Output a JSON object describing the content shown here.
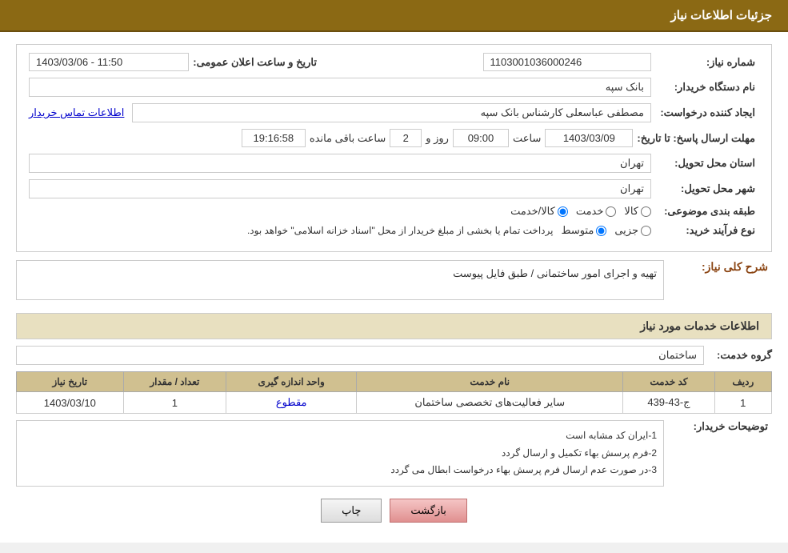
{
  "header": {
    "title": "جزئیات اطلاعات نیاز"
  },
  "fields": {
    "need_number_label": "شماره نیاز:",
    "need_number_value": "1103001036000246",
    "buyer_org_label": "نام دستگاه خریدار:",
    "buyer_org_value": "بانک سپه",
    "creator_label": "ایجاد کننده درخواست:",
    "creator_value": "مصطفی عباسعلی کارشناس بانک سپه",
    "creator_link": "اطلاعات تماس خریدار",
    "deadline_label": "مهلت ارسال پاسخ: تا تاریخ:",
    "deadline_date": "1403/03/09",
    "deadline_time_label": "ساعت",
    "deadline_time": "09:00",
    "deadline_days_label": "روز و",
    "deadline_days": "2",
    "deadline_remaining": "19:16:58",
    "deadline_remaining_label": "ساعت باقی مانده",
    "province_label": "استان محل تحویل:",
    "province_value": "تهران",
    "city_label": "شهر محل تحویل:",
    "city_value": "تهران",
    "category_label": "طبقه بندی موضوعی:",
    "category_options": [
      "کالا",
      "خدمت",
      "کالا/خدمت"
    ],
    "category_selected": "کالا",
    "process_label": "نوع فرآیند خرید:",
    "process_options": [
      "جزیی",
      "متوسط"
    ],
    "process_note": "پرداخت تمام یا بخشی از مبلغ خریدار از محل \"اسناد خزانه اسلامی\" خواهد بود.",
    "date_range_label": "تاریخ و ساعت اعلان عمومی:",
    "date_range_value": "1403/03/06 - 11:50"
  },
  "description_section": {
    "title": "شرح کلی نیاز:",
    "value": "تهیه و اجرای امور ساختمانی / طبق فایل پیوست"
  },
  "services_section": {
    "title": "اطلاعات خدمات مورد نیاز",
    "group_label": "گروه خدمت:",
    "group_value": "ساختمان",
    "table": {
      "columns": [
        "ردیف",
        "کد خدمت",
        "نام خدمت",
        "واحد اندازه گیری",
        "تعداد / مقدار",
        "تاریخ نیاز"
      ],
      "rows": [
        {
          "row_num": "1",
          "code": "ج-43-439",
          "name": "سایر فعالیت‌های تخصصی ساختمان",
          "unit": "مقطوع",
          "quantity": "1",
          "date": "1403/03/10"
        }
      ]
    }
  },
  "buyer_notes": {
    "label": "توضیحات خریدار:",
    "lines": [
      "1-ایران کد مشابه است",
      "2-فرم پرسش بهاء تکمیل و ارسال گردد",
      "3-در صورت عدم ارسال فرم پرسش بهاء درخواست ابطال می گردد"
    ]
  },
  "buttons": {
    "print_label": "چاپ",
    "back_label": "بازگشت"
  }
}
